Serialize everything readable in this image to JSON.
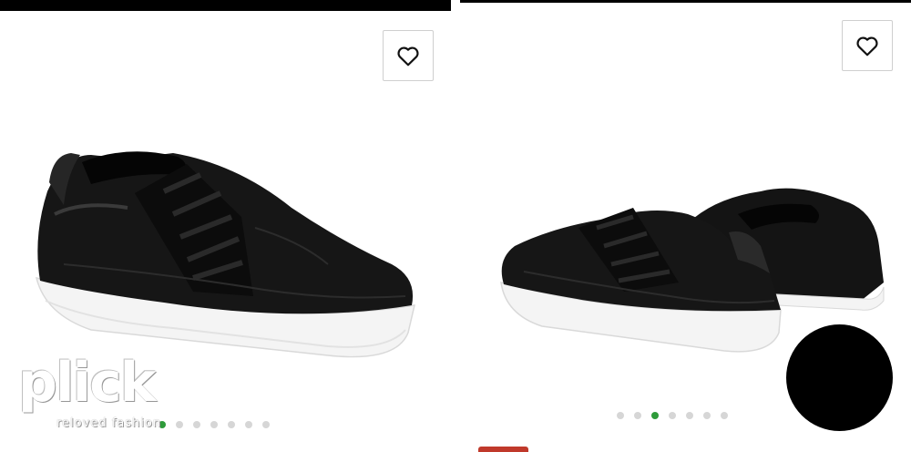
{
  "gallery_left": {
    "wishlist_icon": "heart-outline-icon",
    "dots_count": 7,
    "active_dot_index": 0
  },
  "gallery_right": {
    "wishlist_icon": "heart-outline-icon",
    "dots_count": 7,
    "active_dot_index": 2
  },
  "watermark": {
    "brand": "plick",
    "tagline": "reloved fashion"
  },
  "colors": {
    "active_dot": "#2e9b3a",
    "inactive_dot": "#d6d6d6",
    "shoe": "#151515",
    "sole": "#f4f4f4"
  }
}
